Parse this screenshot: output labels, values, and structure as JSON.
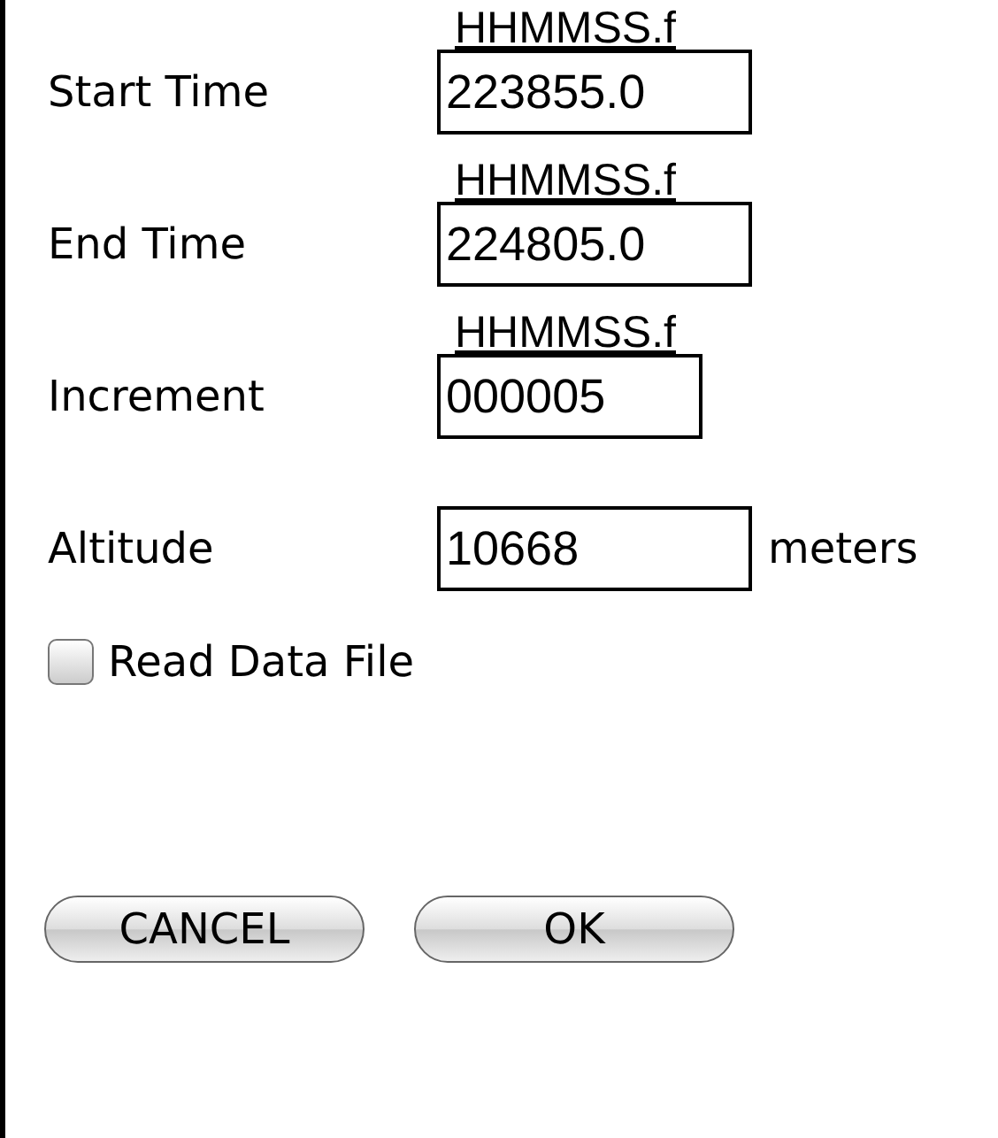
{
  "fields": [
    {
      "label": "Start Time",
      "format": "HHMMSS.f",
      "value": "223855.0"
    },
    {
      "label": "End Time",
      "format": "HHMMSS.f",
      "value": "224805.0"
    },
    {
      "label": "Increment",
      "format": "HHMMSS.f",
      "value": "000005"
    },
    {
      "label": "Altitude",
      "value": "10668",
      "unit": "meters"
    }
  ],
  "checkbox": {
    "label": "Read Data File",
    "checked": false
  },
  "buttons": [
    "CANCEL",
    "OK"
  ]
}
